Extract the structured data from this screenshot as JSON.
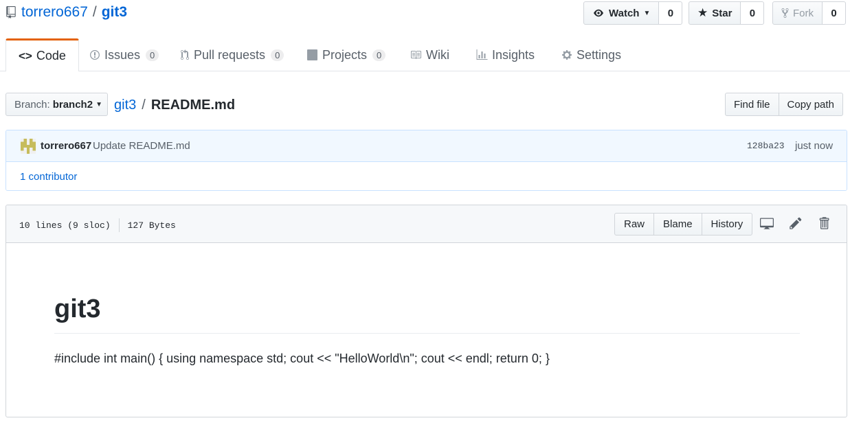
{
  "repo": {
    "owner": "torrero667",
    "separator": "/",
    "name": "git3"
  },
  "header_actions": {
    "watch": {
      "label": "Watch",
      "count": "0"
    },
    "star": {
      "label": "Star",
      "count": "0"
    },
    "fork": {
      "label": "Fork",
      "count": "0"
    }
  },
  "tabs": [
    {
      "label": "Code",
      "selected": true
    },
    {
      "label": "Issues",
      "count": "0"
    },
    {
      "label": "Pull requests",
      "count": "0"
    },
    {
      "label": "Projects",
      "count": "0"
    },
    {
      "label": "Wiki"
    },
    {
      "label": "Insights"
    },
    {
      "label": "Settings"
    }
  ],
  "file_nav": {
    "branch_prefix": "Branch:",
    "branch_name": "branch2",
    "path_root": "git3",
    "path_separator": "/",
    "file_name": "README.md",
    "find_file": "Find file",
    "copy_path": "Copy path"
  },
  "commit": {
    "author": "torrero667",
    "message": "Update README.md",
    "sha": "128ba23",
    "time": "just now",
    "contributors": "1 contributor"
  },
  "file": {
    "lines": "10 lines (9 sloc)",
    "size": "127 Bytes",
    "raw": "Raw",
    "blame": "Blame",
    "history": "History"
  },
  "readme": {
    "title": "git3",
    "body": "#include int main() { using namespace std; cout << \"HelloWorld\\n\"; cout << endl; return 0; }"
  },
  "colors": {
    "link": "#0366d6",
    "tab_accent": "#e36209",
    "commit_bg": "#f1f8ff"
  }
}
